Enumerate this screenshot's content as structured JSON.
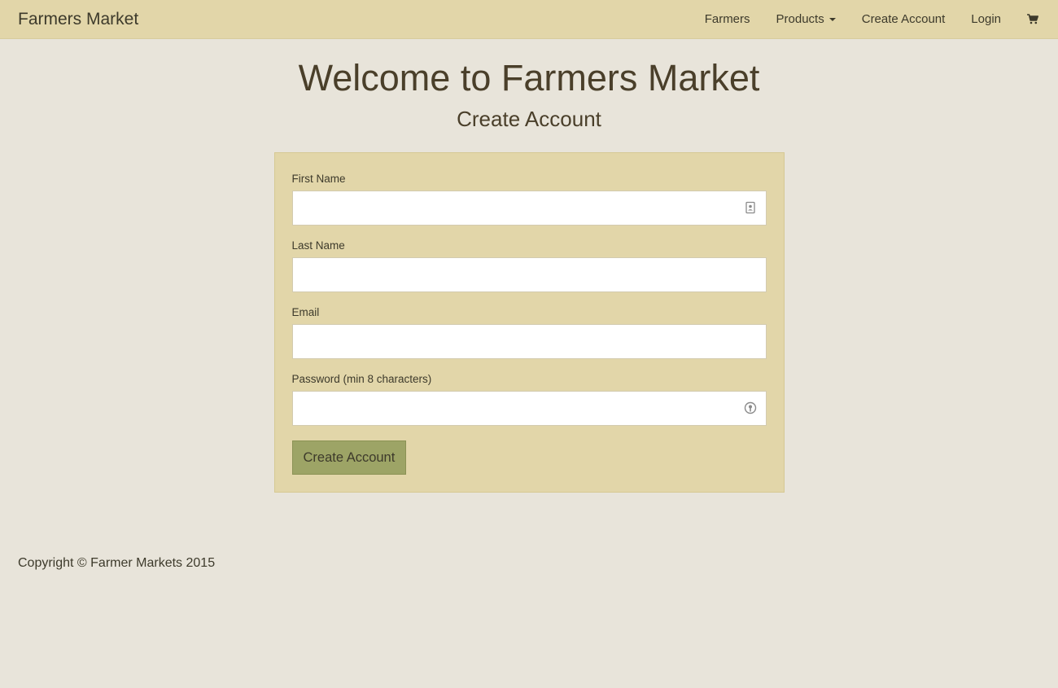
{
  "navbar": {
    "brand": "Farmers Market",
    "links": {
      "farmers": "Farmers",
      "products": "Products",
      "create_account": "Create Account",
      "login": "Login"
    },
    "cart_icon": "shopping-cart-icon"
  },
  "main": {
    "title": "Welcome to Farmers Market",
    "subtitle": "Create Account"
  },
  "form": {
    "first_name": {
      "label": "First Name",
      "value": "",
      "placeholder": ""
    },
    "last_name": {
      "label": "Last Name",
      "value": "",
      "placeholder": ""
    },
    "email": {
      "label": "Email",
      "value": "",
      "placeholder": ""
    },
    "password": {
      "label": "Password (min 8 characters)",
      "value": "",
      "placeholder": ""
    },
    "submit_label": "Create Account"
  },
  "footer": {
    "copyright": "Copyright © Farmer Markets 2015"
  },
  "colors": {
    "page_background": "#e8e4da",
    "navbar_background": "#e2d6a9",
    "panel_background": "#e2d6a9",
    "button_background": "#9da466",
    "text": "#3d3a2b"
  }
}
